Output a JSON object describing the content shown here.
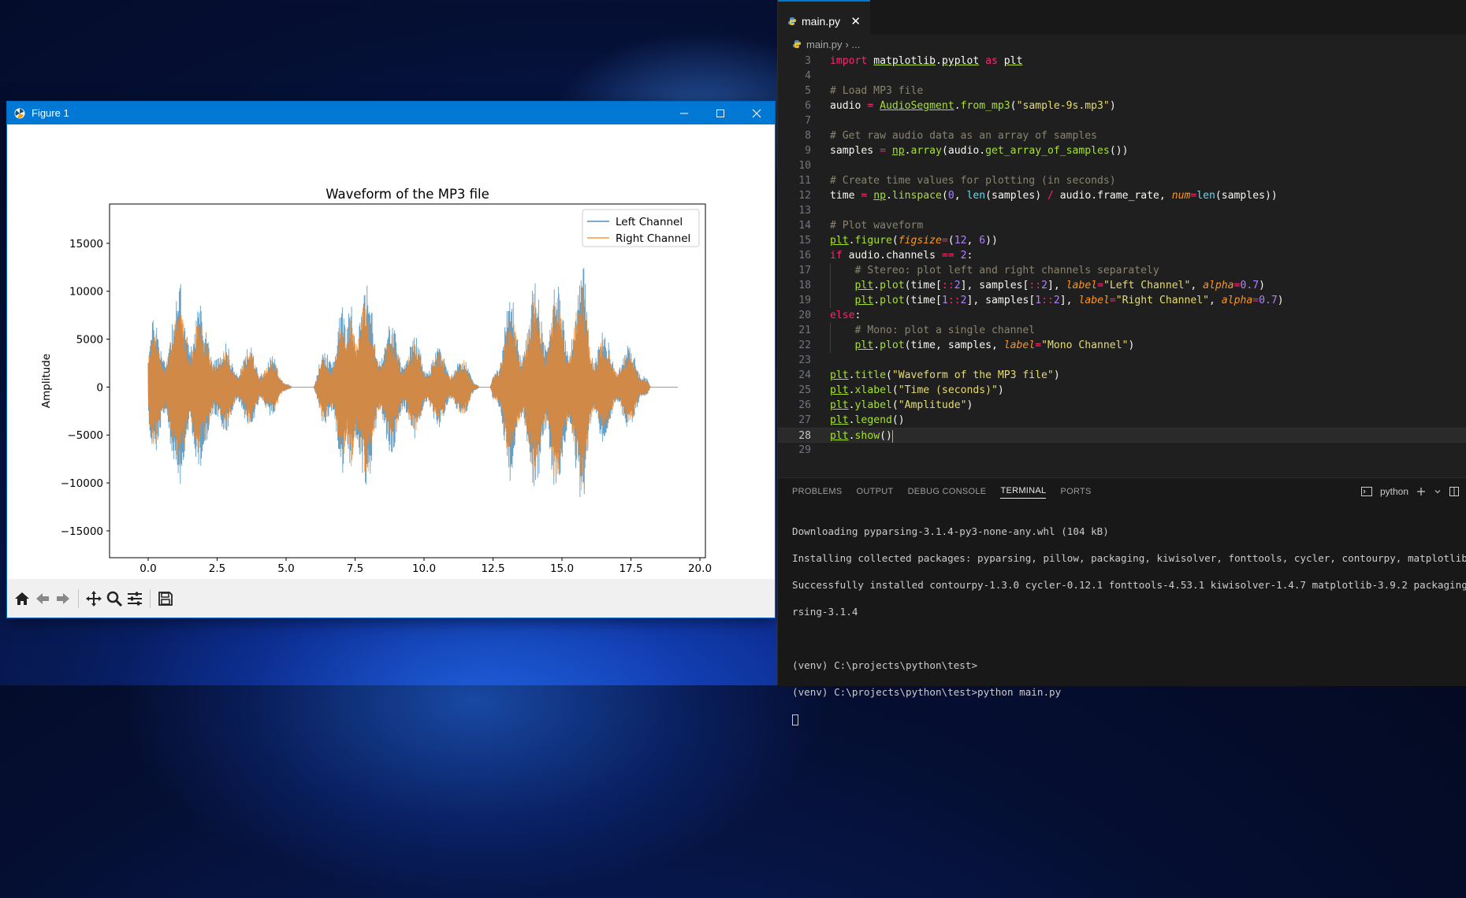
{
  "figure_window": {
    "title": "Figure 1",
    "toolbar_icons": [
      "home-icon",
      "back-icon",
      "forward-icon",
      "pan-icon",
      "zoom-icon",
      "configure-subplots-icon",
      "save-icon"
    ]
  },
  "chart_data": {
    "type": "line",
    "title": "Waveform of the MP3 file",
    "xlabel": "Time (seconds)",
    "ylabel": "Amplitude",
    "xlim": [
      -1.4,
      20.2
    ],
    "ylim": [
      -17800,
      19100
    ],
    "x_ticks": [
      0.0,
      2.5,
      5.0,
      7.5,
      10.0,
      12.5,
      15.0,
      17.5,
      20.0
    ],
    "x_tick_labels": [
      "0.0",
      "2.5",
      "5.0",
      "7.5",
      "10.0",
      "12.5",
      "15.0",
      "17.5",
      "20.0"
    ],
    "y_ticks": [
      -15000,
      -10000,
      -5000,
      0,
      5000,
      10000,
      15000
    ],
    "y_tick_labels": [
      "−15000",
      "−10000",
      "−5000",
      "0",
      "5000",
      "10000",
      "15000"
    ],
    "legend_position": "upper right",
    "series": [
      {
        "name": "Left Channel",
        "color": "#1f77b4",
        "envelope": {
          "t": [
            0.0,
            0.2,
            0.5,
            0.8,
            1.0,
            1.2,
            1.4,
            1.6,
            1.8,
            2.0,
            2.2,
            2.4,
            2.6,
            3.0,
            3.4,
            3.8,
            4.2,
            4.6,
            5.2,
            6.0,
            6.4,
            6.8,
            7.0,
            7.2,
            7.4,
            7.6,
            7.8,
            8.0,
            8.2,
            8.4,
            8.8,
            9.2,
            9.6,
            10.0,
            10.4,
            10.8,
            11.2,
            11.6,
            12.0,
            12.4,
            12.8,
            13.2,
            13.4,
            13.8,
            14.2,
            14.6,
            15.0,
            15.2,
            15.4,
            15.6,
            15.8,
            16.2,
            16.6,
            17.0,
            17.4,
            17.8,
            18.2,
            18.6,
            19.0,
            19.2
          ],
          "amp": [
            5500,
            7500,
            7000,
            11000,
            9000,
            12500,
            13000,
            11500,
            10500,
            6500,
            9000,
            8000,
            5000,
            4500,
            4000,
            4500,
            4000,
            3000,
            0,
            0,
            5000,
            9000,
            11000,
            6000,
            17500,
            15500,
            12000,
            10500,
            9000,
            8000,
            7000,
            6500,
            5500,
            5000,
            4500,
            4000,
            3500,
            3000,
            0,
            0,
            8000,
            10500,
            9000,
            10000,
            12500,
            13000,
            11000,
            10000,
            13000,
            11500,
            13500,
            8000,
            5500,
            5000,
            4500,
            4500,
            0,
            0,
            0,
            0
          ]
        }
      },
      {
        "name": "Right Channel",
        "color": "#ff7f0e",
        "envelope": {
          "t": [
            0.0,
            0.2,
            0.5,
            0.8,
            1.0,
            1.2,
            1.4,
            1.6,
            1.8,
            2.0,
            2.2,
            2.4,
            2.6,
            3.0,
            3.4,
            3.8,
            4.2,
            4.6,
            5.2,
            6.0,
            6.4,
            6.8,
            7.0,
            7.2,
            7.4,
            7.6,
            7.8,
            8.0,
            8.2,
            8.4,
            8.8,
            9.2,
            9.6,
            10.0,
            10.4,
            10.8,
            11.2,
            11.6,
            12.0,
            12.4,
            12.8,
            13.2,
            13.4,
            13.8,
            14.2,
            14.6,
            15.0,
            15.2,
            15.4,
            15.6,
            15.8,
            16.2,
            16.6,
            17.0,
            17.4,
            17.8,
            18.2,
            18.6,
            19.0,
            19.2
          ],
          "amp": [
            5000,
            6500,
            6500,
            9500,
            8000,
            10000,
            11500,
            10000,
            9000,
            6000,
            8000,
            7000,
            4500,
            4000,
            3500,
            4000,
            3500,
            2800,
            0,
            0,
            4500,
            8000,
            9500,
            5500,
            17800,
            15000,
            11000,
            9000,
            8000,
            7000,
            6000,
            5800,
            5000,
            4500,
            4000,
            3500,
            3200,
            2800,
            0,
            0,
            7000,
            9000,
            8000,
            9000,
            11000,
            12000,
            10000,
            9500,
            12500,
            10500,
            12500,
            7000,
            5000,
            4500,
            4000,
            4000,
            0,
            0,
            0,
            0
          ]
        }
      }
    ]
  },
  "vscode": {
    "tab_label": "main.py",
    "tab_close": "✕",
    "breadcrumb_file": "main.py",
    "breadcrumb_sep": "› ...",
    "panel_tabs": [
      "PROBLEMS",
      "OUTPUT",
      "DEBUG CONSOLE",
      "TERMINAL",
      "PORTS"
    ],
    "terminal_name": "python",
    "terminal_lines": [
      "Downloading pyparsing-3.1.4-py3-none-any.whl (104 kB)",
      "Installing collected packages: pyparsing, pillow, packaging, kiwisolver, fonttools, cycler, contourpy, matplotlib",
      "Successfully installed contourpy-1.3.0 cycler-0.12.1 fonttools-4.53.1 kiwisolver-1.4.7 matplotlib-3.9.2 packaging-24.1 pil",
      "rsing-3.1.4",
      "",
      "(venv) C:\\projects\\python\\test>",
      "(venv) C:\\projects\\python\\test>python main.py"
    ],
    "code_lines": [
      {
        "n": "3",
        "tokens": [
          [
            "kw",
            "import "
          ],
          [
            "mod",
            "matplotlib"
          ],
          [
            "",
            "."
          ],
          [
            "mod",
            "pyplot"
          ],
          [
            "",
            " "
          ],
          [
            "kw",
            "as"
          ],
          [
            "",
            " "
          ],
          [
            "mod",
            "plt"
          ]
        ]
      },
      {
        "n": "4",
        "tokens": []
      },
      {
        "n": "5",
        "tokens": [
          [
            "cmt",
            "# Load MP3 file"
          ]
        ]
      },
      {
        "n": "6",
        "tokens": [
          [
            "",
            "audio "
          ],
          [
            "op",
            "="
          ],
          [
            "",
            " "
          ],
          [
            "cls",
            "AudioSegment"
          ],
          [
            "",
            "."
          ],
          [
            "fn",
            "from_mp3"
          ],
          [
            "",
            "("
          ],
          [
            "str",
            "\"sample-9s.mp3\""
          ],
          [
            "",
            ")"
          ]
        ]
      },
      {
        "n": "7",
        "tokens": []
      },
      {
        "n": "8",
        "tokens": [
          [
            "cmt",
            "# Get raw audio data as an array of samples"
          ]
        ]
      },
      {
        "n": "9",
        "tokens": [
          [
            "",
            "samples "
          ],
          [
            "op",
            "="
          ],
          [
            "",
            " "
          ],
          [
            "cls",
            "np"
          ],
          [
            "",
            "."
          ],
          [
            "fn",
            "array"
          ],
          [
            "",
            "(audio."
          ],
          [
            "fn",
            "get_array_of_samples"
          ],
          [
            "",
            "())"
          ]
        ]
      },
      {
        "n": "10",
        "tokens": []
      },
      {
        "n": "11",
        "tokens": [
          [
            "cmt",
            "# Create time values for plotting (in seconds)"
          ]
        ]
      },
      {
        "n": "12",
        "tokens": [
          [
            "",
            "time "
          ],
          [
            "op",
            "="
          ],
          [
            "",
            " "
          ],
          [
            "cls",
            "np"
          ],
          [
            "",
            "."
          ],
          [
            "fn",
            "linspace"
          ],
          [
            "",
            "("
          ],
          [
            "num",
            "0"
          ],
          [
            "",
            ", "
          ],
          [
            "bi",
            "len"
          ],
          [
            "",
            "(samples) "
          ],
          [
            "op",
            "/"
          ],
          [
            "",
            " audio.frame_rate, "
          ],
          [
            "param",
            "num"
          ],
          [
            "op",
            "="
          ],
          [
            "bi",
            "len"
          ],
          [
            "",
            "(samples))"
          ]
        ]
      },
      {
        "n": "13",
        "tokens": []
      },
      {
        "n": "14",
        "tokens": [
          [
            "cmt",
            "# Plot waveform"
          ]
        ]
      },
      {
        "n": "15",
        "tokens": [
          [
            "cls",
            "plt"
          ],
          [
            "",
            "."
          ],
          [
            "fn",
            "figure"
          ],
          [
            "",
            "("
          ],
          [
            "param",
            "figsize"
          ],
          [
            "op",
            "="
          ],
          [
            "",
            "("
          ],
          [
            "num",
            "12"
          ],
          [
            "",
            ", "
          ],
          [
            "num",
            "6"
          ],
          [
            "",
            "))"
          ]
        ]
      },
      {
        "n": "16",
        "tokens": [
          [
            "kw",
            "if"
          ],
          [
            "",
            " audio.channels "
          ],
          [
            "op",
            "=="
          ],
          [
            "",
            " "
          ],
          [
            "num",
            "2"
          ],
          [
            "",
            ":"
          ]
        ]
      },
      {
        "n": "17",
        "tokens": [
          [
            "",
            "    "
          ],
          [
            "cmt",
            "# Stereo: plot left and right channels separately"
          ]
        ]
      },
      {
        "n": "18",
        "tokens": [
          [
            "",
            "    "
          ],
          [
            "cls",
            "plt"
          ],
          [
            "",
            "."
          ],
          [
            "fn",
            "plot"
          ],
          [
            "",
            "(time["
          ],
          [
            "op",
            "::"
          ],
          [
            "num",
            "2"
          ],
          [
            "",
            "], samples["
          ],
          [
            "op",
            "::"
          ],
          [
            "num",
            "2"
          ],
          [
            "",
            "], "
          ],
          [
            "param",
            "label"
          ],
          [
            "op",
            "="
          ],
          [
            "str",
            "\"Left Channel\""
          ],
          [
            "",
            ", "
          ],
          [
            "param",
            "alpha"
          ],
          [
            "op",
            "="
          ],
          [
            "num",
            "0.7"
          ],
          [
            "",
            ")"
          ]
        ]
      },
      {
        "n": "19",
        "tokens": [
          [
            "",
            "    "
          ],
          [
            "cls",
            "plt"
          ],
          [
            "",
            "."
          ],
          [
            "fn",
            "plot"
          ],
          [
            "",
            "(time["
          ],
          [
            "num",
            "1"
          ],
          [
            "op",
            "::"
          ],
          [
            "num",
            "2"
          ],
          [
            "",
            "], samples["
          ],
          [
            "num",
            "1"
          ],
          [
            "op",
            "::"
          ],
          [
            "num",
            "2"
          ],
          [
            "",
            "], "
          ],
          [
            "param",
            "label"
          ],
          [
            "op",
            "="
          ],
          [
            "str",
            "\"Right Channel\""
          ],
          [
            "",
            ", "
          ],
          [
            "param",
            "alpha"
          ],
          [
            "op",
            "="
          ],
          [
            "num",
            "0.7"
          ],
          [
            "",
            ")"
          ]
        ]
      },
      {
        "n": "20",
        "tokens": [
          [
            "kw",
            "else"
          ],
          [
            "",
            ":"
          ]
        ]
      },
      {
        "n": "21",
        "tokens": [
          [
            "",
            "    "
          ],
          [
            "cmt",
            "# Mono: plot a single channel"
          ]
        ]
      },
      {
        "n": "22",
        "tokens": [
          [
            "",
            "    "
          ],
          [
            "cls",
            "plt"
          ],
          [
            "",
            "."
          ],
          [
            "fn",
            "plot"
          ],
          [
            "",
            "(time, samples, "
          ],
          [
            "param",
            "label"
          ],
          [
            "op",
            "="
          ],
          [
            "str",
            "\"Mono Channel\""
          ],
          [
            "",
            ")"
          ]
        ]
      },
      {
        "n": "23",
        "tokens": []
      },
      {
        "n": "24",
        "tokens": [
          [
            "cls",
            "plt"
          ],
          [
            "",
            "."
          ],
          [
            "fn",
            "title"
          ],
          [
            "",
            "("
          ],
          [
            "str",
            "\"Waveform of the MP3 file\""
          ],
          [
            "",
            ")"
          ]
        ]
      },
      {
        "n": "25",
        "tokens": [
          [
            "cls",
            "plt"
          ],
          [
            "",
            "."
          ],
          [
            "fn",
            "xlabel"
          ],
          [
            "",
            "("
          ],
          [
            "str",
            "\"Time (seconds)\""
          ],
          [
            "",
            ")"
          ]
        ]
      },
      {
        "n": "26",
        "tokens": [
          [
            "cls",
            "plt"
          ],
          [
            "",
            "."
          ],
          [
            "fn",
            "ylabel"
          ],
          [
            "",
            "("
          ],
          [
            "str",
            "\"Amplitude\""
          ],
          [
            "",
            ")"
          ]
        ]
      },
      {
        "n": "27",
        "tokens": [
          [
            "cls",
            "plt"
          ],
          [
            "",
            "."
          ],
          [
            "fn",
            "legend"
          ],
          [
            "",
            "()"
          ]
        ]
      },
      {
        "n": "28",
        "tokens": [
          [
            "cls",
            "plt"
          ],
          [
            "",
            "."
          ],
          [
            "fn",
            "show"
          ],
          [
            "",
            "()"
          ]
        ]
      },
      {
        "n": "29",
        "tokens": []
      }
    ]
  }
}
